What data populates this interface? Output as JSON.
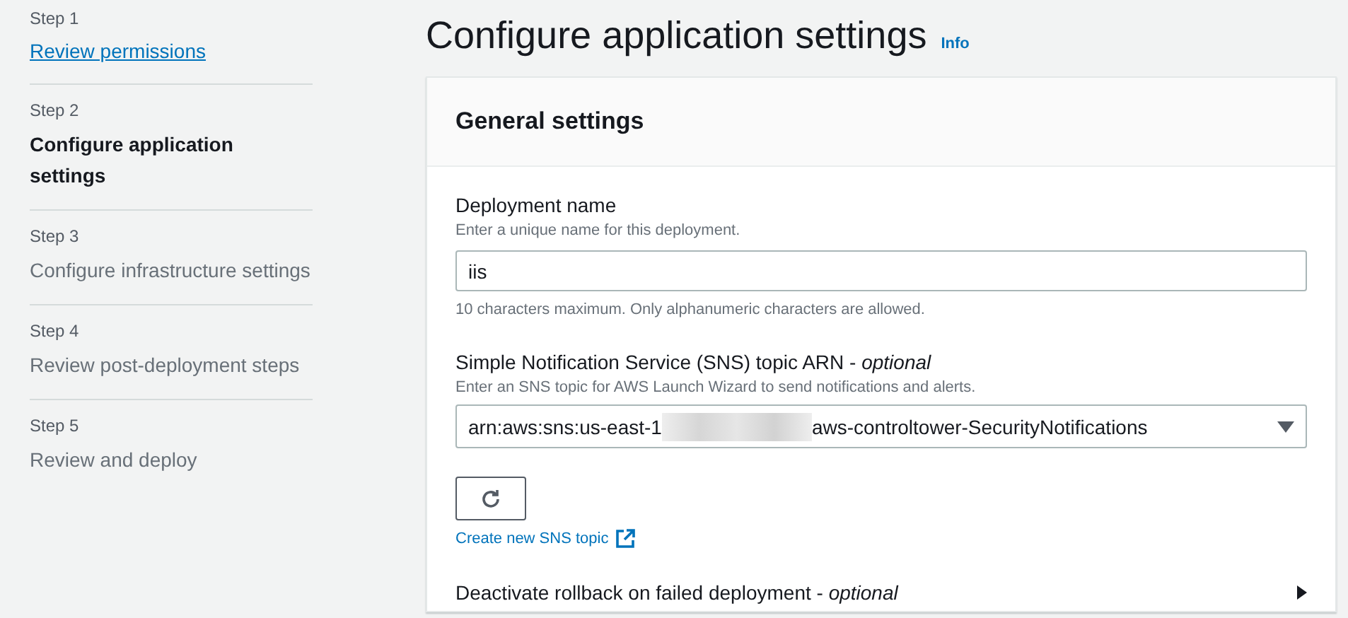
{
  "steps": [
    {
      "step": "Step 1",
      "title": "Review permissions",
      "kind": "link",
      "selected": false
    },
    {
      "step": "Step 2",
      "title": "Configure application settings",
      "kind": "text",
      "selected": true
    },
    {
      "step": "Step 3",
      "title": "Configure infrastructure settings",
      "kind": "text",
      "selected": false
    },
    {
      "step": "Step 4",
      "title": "Review post-deployment steps",
      "kind": "text",
      "selected": false
    },
    {
      "step": "Step 5",
      "title": "Review and deploy",
      "kind": "text",
      "selected": false
    }
  ],
  "page": {
    "title": "Configure application settings",
    "info": "Info"
  },
  "panel": {
    "title": "General settings",
    "deployment_name": {
      "label": "Deployment name",
      "description": "Enter a unique name for this deployment.",
      "value": "iis",
      "constraint": "10 characters maximum. Only alphanumeric characters are allowed."
    },
    "sns_topic": {
      "label": "Simple Notification Service (SNS) topic ARN - *optional*",
      "description": "Enter an SNS topic for AWS Launch Wizard to send notifications and alerts.",
      "value_start": "arn:aws:sns:us-east-1",
      "value_end": "aws-controltower-SecurityNotifications"
    },
    "create_link": "Create new SNS topic",
    "rollback_label": "Deactivate rollback on failed deployment - *optional*"
  }
}
